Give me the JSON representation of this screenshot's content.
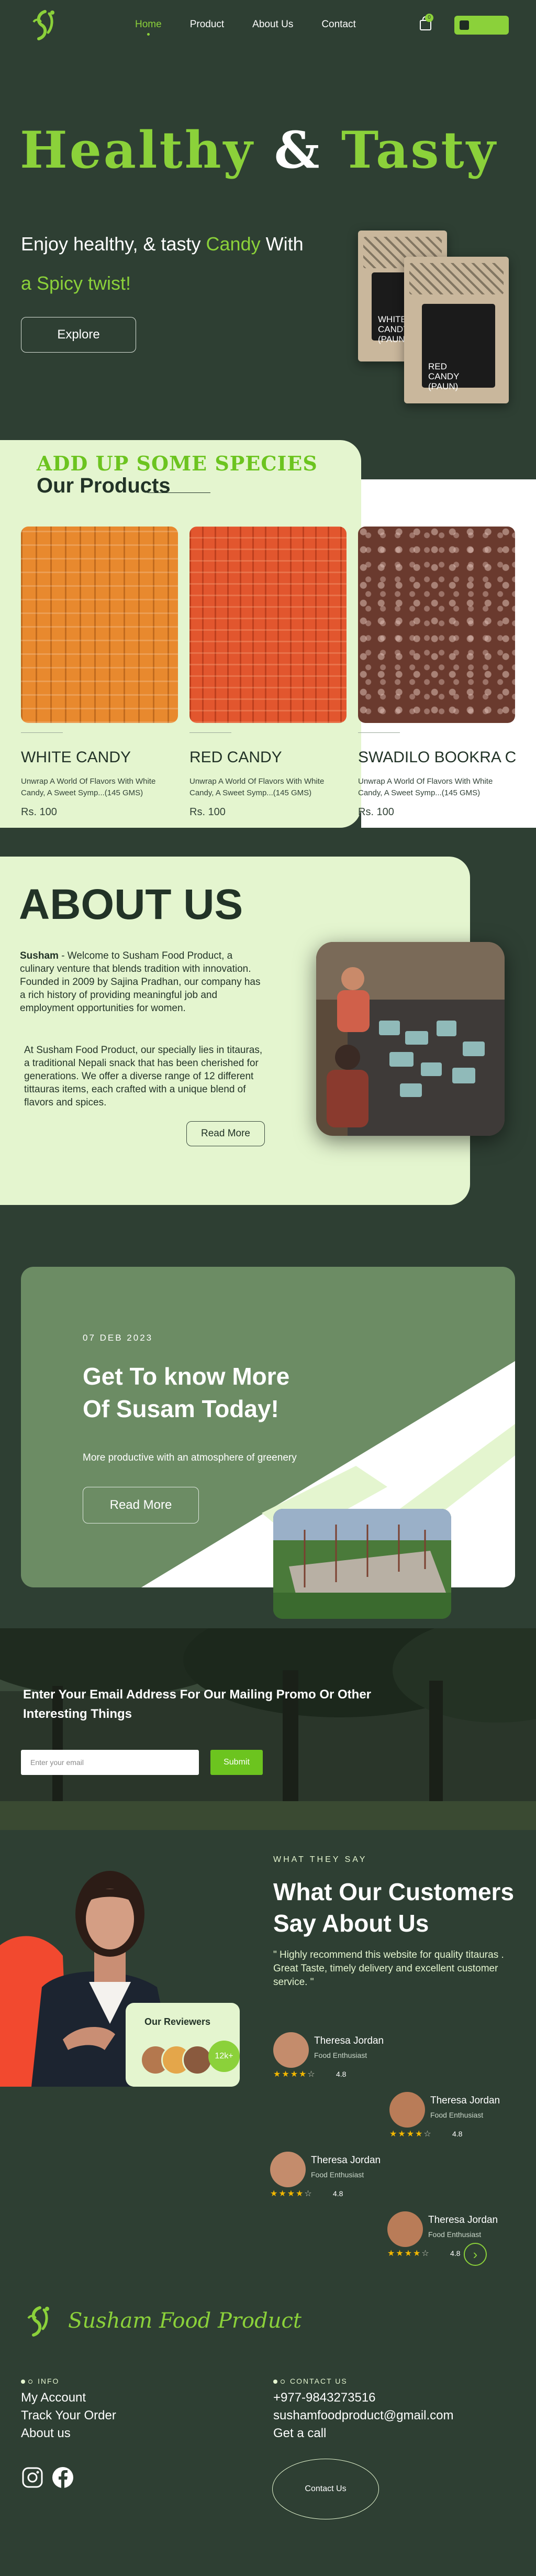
{
  "nav": {
    "items": [
      {
        "label": "Home",
        "active": true
      },
      {
        "label": "Product",
        "active": false
      },
      {
        "label": "About Us",
        "active": false
      },
      {
        "label": "Contact",
        "active": false
      }
    ],
    "cart_count": "0",
    "accent": "#8bd13a"
  },
  "hero": {
    "title_a": "Healthy",
    "title_amp": "&",
    "title_b": "Tasty",
    "sub_a": "Enjoy healthy, & tasty",
    "sub_highlight": "Candy",
    "sub_b": "With",
    "sub2": "a Spicy twist!",
    "explore": "Explore",
    "bag_back_label": [
      "WHITE",
      "CANDY",
      "(PAUN)"
    ],
    "bag_front_label": [
      "RED",
      "CANDY",
      "(PAUN)"
    ]
  },
  "products": {
    "kicker": "ADD UP SOME SPECIES",
    "title": "Our Products",
    "items": [
      {
        "name": "WHITE CANDY",
        "desc": "Unwrap A World Of Flavors With White Candy, A Sweet Symp...(145 GMS)",
        "price": "Rs. 100"
      },
      {
        "name": "RED CANDY",
        "desc": "Unwrap A World Of Flavors With White Candy, A Sweet Symp...(145 GMS)",
        "price": "Rs. 100"
      },
      {
        "name": "SWADILO BOOKRA C",
        "desc": "Unwrap A World Of Flavors With White Candy, A Sweet Symp...(145 GMS)",
        "price": "Rs. 100"
      }
    ]
  },
  "about": {
    "title": "ABOUT US",
    "brand": "Susham",
    "p1": " - Welcome to Susham Food Product, a culinary venture that blends tradition with innovation. Founded in 2009 by Sajina Pradhan, our company has a rich history of providing meaningful job and employment opportunities for women.",
    "p2": "At Susham Food Product, our specially lies in titauras, a traditional Nepali snack that has been cherished for generations. We offer a diverse range of 12 different tittauras items, each crafted with a unique blend of flavors and spices.",
    "read_more": "Read More"
  },
  "know": {
    "date": "07 DEB 2023",
    "title_l1": "Get To know More",
    "title_l2": "Of Susam Today!",
    "sub": "More productive with an atmosphere of greenery",
    "btn": "Read More"
  },
  "newsletter": {
    "title": "Enter Your Email Address For Our Mailing Promo Or Other Interesting Things",
    "placeholder": "Enter your email",
    "submit": "Submit"
  },
  "testimonials": {
    "kicker": "WHAT THEY SAY",
    "title_l1": "What Our Customers",
    "title_l2": "Say About Us",
    "quote": "\" Highly recommend this website for quality titauras . Great Taste, timely delivery and excellent customer service. \"",
    "reviewers_title": "Our Reviewers",
    "reviewers_count": "12k+",
    "reviews": [
      {
        "name": "Theresa Jordan",
        "role": "Food Enthusiast",
        "rating": "4.8",
        "stars": 4
      },
      {
        "name": "Theresa Jordan",
        "role": "Food Enthusiast",
        "rating": "4.8",
        "stars": 4
      },
      {
        "name": "Theresa Jordan",
        "role": "Food Enthusiast",
        "rating": "4.8",
        "stars": 4
      },
      {
        "name": "Theresa Jordan",
        "role": "Food Enthusiast",
        "rating": "4.8",
        "stars": 4
      }
    ]
  },
  "footer": {
    "brand": "Susham Food Product",
    "info_head": "INFO",
    "info_links": [
      "My Account",
      "Track Your Order",
      "About us"
    ],
    "contact_head": "CONTACT US",
    "phone": "+977-9843273516",
    "email": "sushamfoodproduct@gmail.com",
    "call": "Get a call",
    "contact_btn": "Contact Us",
    "socials": [
      "instagram-icon",
      "facebook-icon"
    ]
  }
}
